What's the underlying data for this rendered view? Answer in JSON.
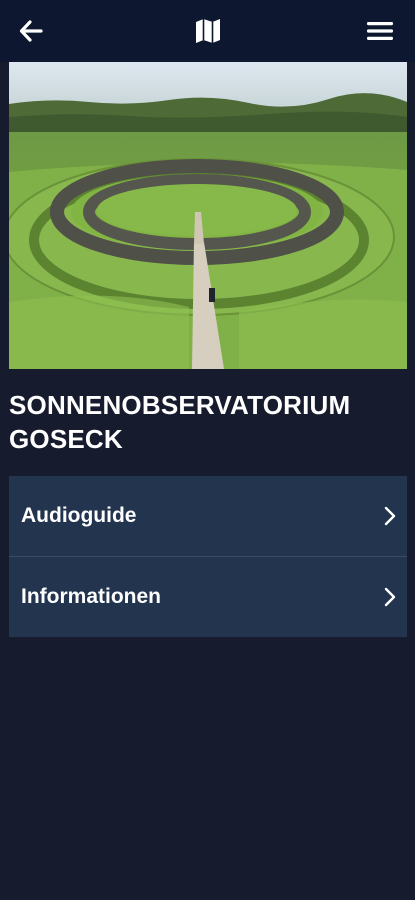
{
  "header": {
    "back_icon": "arrow-left-icon",
    "map_icon": "map-icon",
    "menu_icon": "hamburger-menu-icon"
  },
  "hero_image": {
    "subject": "aerial-photo-circular-wooden-palisade"
  },
  "page": {
    "title": "SONNENOBSERVATORIUM GOSECK"
  },
  "menu": {
    "items": [
      {
        "label": "Audioguide",
        "icon": "chevron-right-icon"
      },
      {
        "label": "Informationen",
        "icon": "chevron-right-icon"
      }
    ]
  },
  "colors": {
    "background": "#171b2e",
    "topbar": "#0d1730",
    "menu_item": "#23344f",
    "text": "#ffffff"
  }
}
